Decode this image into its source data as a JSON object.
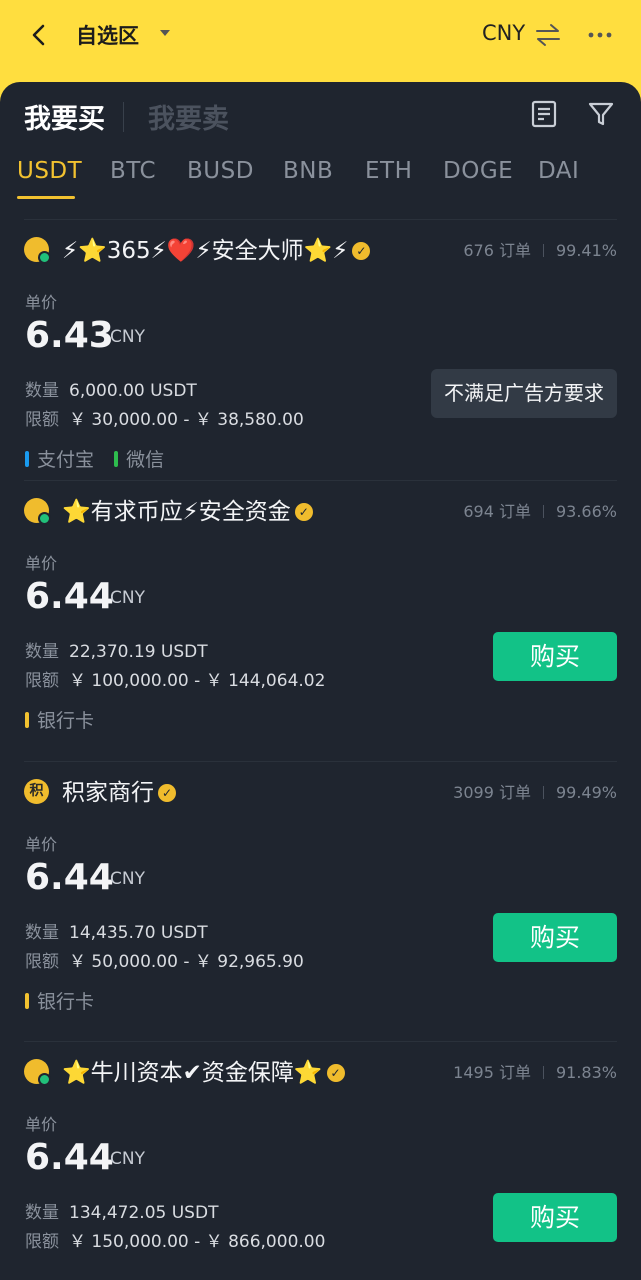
{
  "header": {
    "title": "自选区",
    "currency": "CNY"
  },
  "side_tabs": {
    "buy": "我要买",
    "sell": "我要卖"
  },
  "coin_tabs": [
    "USDT",
    "BTC",
    "BUSD",
    "BNB",
    "ETH",
    "DOGE",
    "DAI"
  ],
  "active_coin": "USDT",
  "labels": {
    "unit_price": "单价",
    "quantity": "数量",
    "limit": "限额",
    "orders_suffix": "订单",
    "buy_button": "购买"
  },
  "colors": {
    "accent": "#f2c230",
    "buy": "#12c287",
    "alipay": "#1a9bf0",
    "wechat": "#2ebd4e",
    "bank": "#f2c230"
  },
  "ads": [
    {
      "avatar": "",
      "merchant": "⚡⭐365⚡❤️⚡安全大师⭐⚡",
      "orders": "676 订单",
      "rate": "99.41%",
      "price": "6.43",
      "price_currency": "CNY",
      "quantity": "6,000.00 USDT",
      "limit": "￥ 30,000.00 - ￥ 38,580.00",
      "action": "不满足广告方要求",
      "action_type": "notmet",
      "payments": [
        {
          "name": "支付宝",
          "color": "alipay"
        },
        {
          "name": "微信",
          "color": "wechat"
        }
      ]
    },
    {
      "avatar": "",
      "merchant": "⭐有求币应⚡安全资金",
      "orders": "694 订单",
      "rate": "93.66%",
      "price": "6.44",
      "price_currency": "CNY",
      "quantity": "22,370.19 USDT",
      "limit": "￥ 100,000.00 - ￥ 144,064.02",
      "action": "购买",
      "action_type": "buy",
      "payments": [
        {
          "name": "银行卡",
          "color": "bank"
        }
      ]
    },
    {
      "avatar": "积",
      "merchant": "积家商行",
      "orders": "3099 订单",
      "rate": "99.49%",
      "price": "6.44",
      "price_currency": "CNY",
      "quantity": "14,435.70 USDT",
      "limit": "￥ 50,000.00 - ￥ 92,965.90",
      "action": "购买",
      "action_type": "buy",
      "payments": [
        {
          "name": "银行卡",
          "color": "bank"
        }
      ]
    },
    {
      "avatar": "",
      "merchant": "⭐牛川资本✔资金保障⭐",
      "orders": "1495 订单",
      "rate": "91.83%",
      "price": "6.44",
      "price_currency": "CNY",
      "quantity": "134,472.05 USDT",
      "limit": "￥ 150,000.00 - ￥ 866,000.00",
      "action": "购买",
      "action_type": "buy",
      "payments": []
    }
  ]
}
